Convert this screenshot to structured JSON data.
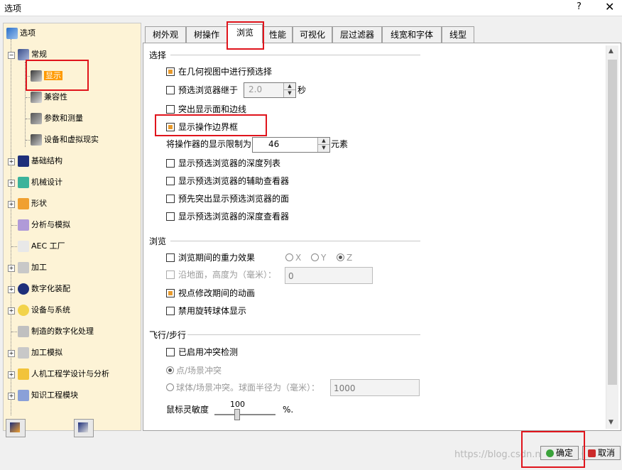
{
  "window": {
    "title": "选项",
    "help": "?",
    "close": "✕"
  },
  "tree": {
    "root": "选项",
    "items": [
      {
        "label": "常规"
      },
      {
        "label": "显示"
      },
      {
        "label": "兼容性"
      },
      {
        "label": "参数和测量"
      },
      {
        "label": "设备和虚拟现实"
      },
      {
        "label": "基础结构"
      },
      {
        "label": "机械设计"
      },
      {
        "label": "形状"
      },
      {
        "label": "分析与模拟"
      },
      {
        "label": "AEC 工厂"
      },
      {
        "label": "加工"
      },
      {
        "label": "数字化装配"
      },
      {
        "label": "设备与系统"
      },
      {
        "label": "制造的数字化处理"
      },
      {
        "label": "加工模拟"
      },
      {
        "label": "人机工程学设计与分析"
      },
      {
        "label": "知识工程模块"
      }
    ]
  },
  "tabs": [
    "树外观",
    "树操作",
    "浏览",
    "性能",
    "可视化",
    "层过滤器",
    "线宽和字体",
    "线型"
  ],
  "active_tab": "浏览",
  "sections": {
    "selection": {
      "title": "选择",
      "preselect_geometry": "在几何视图中进行预选择",
      "preselect_navigator_after": "预选浏览器继于",
      "preselect_navigator_value": "2.0",
      "preselect_navigator_unit": "秒",
      "highlight_faces_edges": "突出显示面和边线",
      "show_manipulator_box": "显示操作边界框",
      "manipulator_limit_label": "将操作器的显示限制为",
      "manipulator_limit_value": "46",
      "manipulator_limit_unit": "元素",
      "show_depth_list": "显示预选浏览器的深度列表",
      "show_aux_viewer": "显示预选浏览器的辅助查看器",
      "prehighlight_faces": "预先突出显示预选浏览器的面",
      "show_depth_viewer": "显示预选浏览器的深度查看器"
    },
    "browse": {
      "title": "浏览",
      "gravity": "浏览期间的重力效果",
      "axis_x": "X",
      "axis_y": "Y",
      "axis_z": "Z",
      "ground_height": "沿地面，高度为（毫米）：",
      "ground_height_value": "0",
      "viewpoint_animation": "视点修改期间的动画",
      "disable_rotation_sphere": "禁用旋转球体显示"
    },
    "fly": {
      "title": "飞行/步行",
      "collision_enabled": "已启用冲突检测",
      "point_collision": "点/场景冲突",
      "sphere_collision": "球体/场景冲突。球面半径为（毫米）：",
      "sphere_radius_value": "1000",
      "mouse_sensitivity": "鼠标灵敏度",
      "mouse_sensitivity_value": "100",
      "mouse_sensitivity_unit": "%."
    }
  },
  "buttons": {
    "ok": "确定",
    "cancel": "取消"
  },
  "watermark": "https://blog.csdn.net/Zhou_GYSA"
}
